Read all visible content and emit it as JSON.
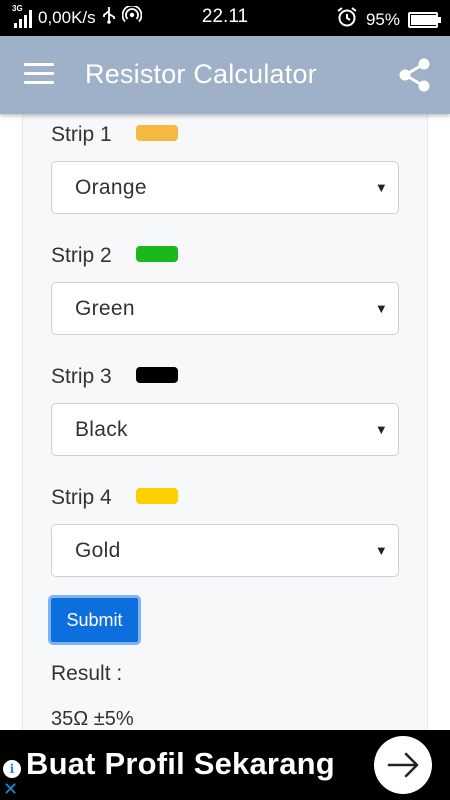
{
  "status_bar": {
    "network_type": "3G",
    "speed": "0,00K/s",
    "time": "22.11",
    "battery": "95%",
    "battery_level": 0.95
  },
  "toolbar": {
    "title": "Resistor Calculator",
    "menu_icon": "hamburger-menu-icon",
    "share_icon": "share-icon"
  },
  "strips": [
    {
      "label": "Strip 1",
      "color": "#f5b942",
      "selected": "Orange"
    },
    {
      "label": "Strip 2",
      "color": "#1ab81a",
      "selected": "Green"
    },
    {
      "label": "Strip 3",
      "color": "#000000",
      "selected": "Black"
    },
    {
      "label": "Strip 4",
      "color": "#ffd000",
      "selected": "Gold"
    }
  ],
  "submit_label": "Submit",
  "result": {
    "label": "Result :",
    "value": "35Ω ±5%"
  },
  "ad": {
    "text": "Buat Profil Sekarang",
    "info_icon": "ad-info-icon",
    "close_icon": "ad-close-icon",
    "arrow_icon": "arrow-right-icon"
  },
  "colors": {
    "toolbar": "#9fb0c9",
    "submit": "#0d6fdd",
    "ad_background": "#000000"
  }
}
